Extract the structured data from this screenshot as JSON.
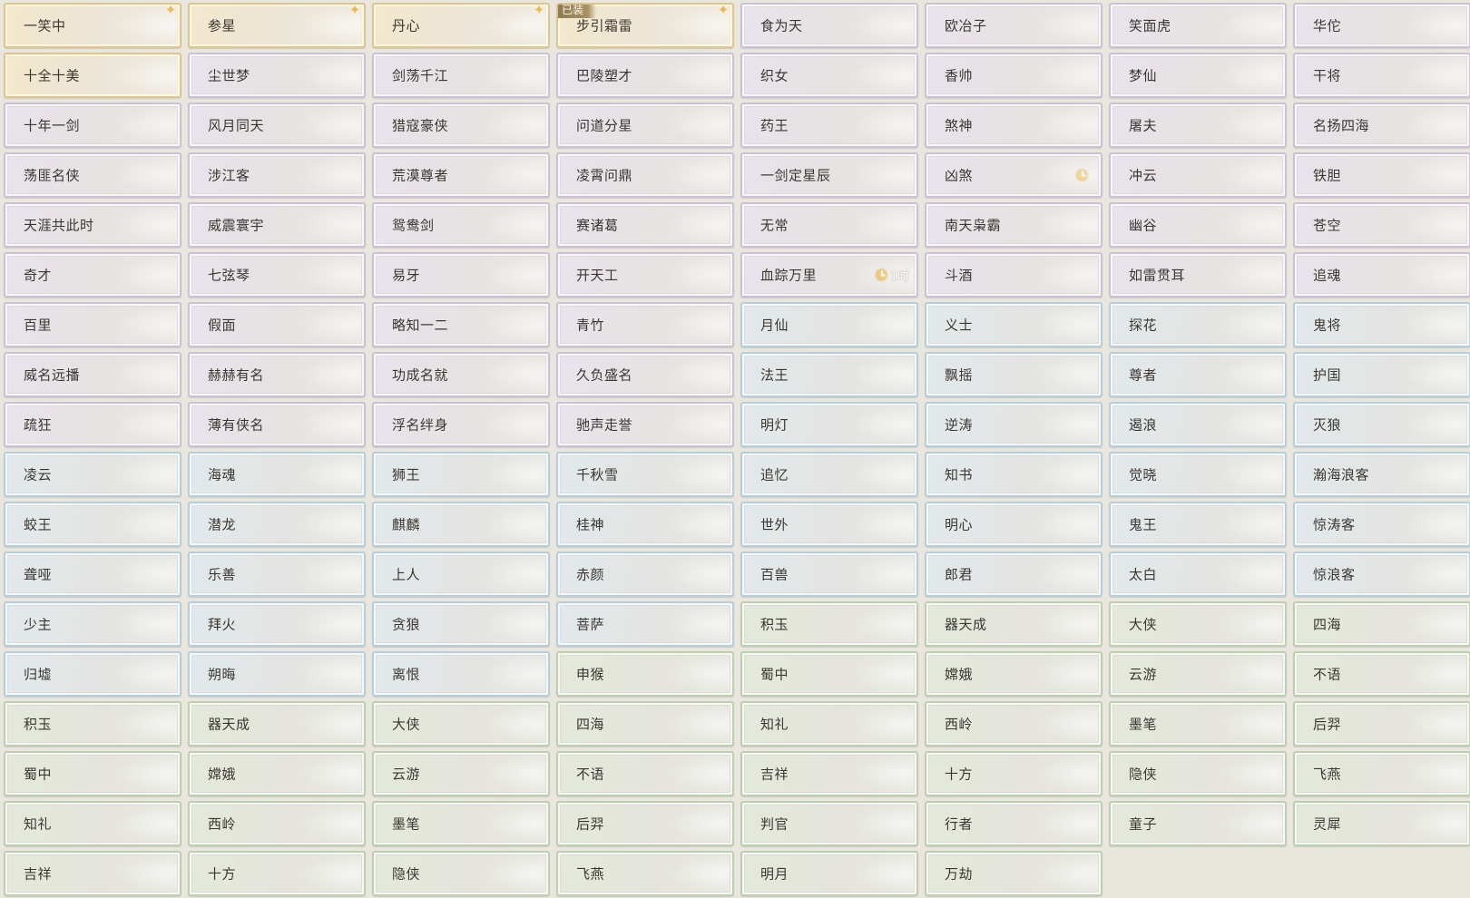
{
  "titles": [
    {
      "label": "一笑中",
      "tier": "gold",
      "sparkle": true
    },
    {
      "label": "参星",
      "tier": "gold",
      "sparkle": true
    },
    {
      "label": "丹心",
      "tier": "gold",
      "sparkle": true
    },
    {
      "label": "步引霜雷",
      "tier": "gold",
      "sparkle": true,
      "equipped": "已装"
    },
    {
      "label": "食为天",
      "tier": "purple"
    },
    {
      "label": "欧冶子",
      "tier": "purple"
    },
    {
      "label": "笑面虎",
      "tier": "purple"
    },
    {
      "label": "华佗",
      "tier": "purple"
    },
    {
      "label": "十全十美",
      "tier": "gold"
    },
    {
      "label": "尘世梦",
      "tier": "purple"
    },
    {
      "label": "剑荡千江",
      "tier": "purple"
    },
    {
      "label": "巴陵塑才",
      "tier": "purple"
    },
    {
      "label": "织女",
      "tier": "purple"
    },
    {
      "label": "香帅",
      "tier": "purple"
    },
    {
      "label": "梦仙",
      "tier": "purple"
    },
    {
      "label": "干将",
      "tier": "purple"
    },
    {
      "label": "十年一剑",
      "tier": "purple"
    },
    {
      "label": "风月同天",
      "tier": "purple"
    },
    {
      "label": "猎寇豪侠",
      "tier": "purple"
    },
    {
      "label": "问道分星",
      "tier": "purple"
    },
    {
      "label": "药王",
      "tier": "purple"
    },
    {
      "label": "煞神",
      "tier": "purple"
    },
    {
      "label": "屠夫",
      "tier": "purple"
    },
    {
      "label": "名扬四海",
      "tier": "purple"
    },
    {
      "label": "荡匪名侠",
      "tier": "purple"
    },
    {
      "label": "涉江客",
      "tier": "purple"
    },
    {
      "label": "荒漠尊者",
      "tier": "purple"
    },
    {
      "label": "凌霄问鼎",
      "tier": "purple"
    },
    {
      "label": "一剑定星辰",
      "tier": "purple"
    },
    {
      "label": "凶煞",
      "tier": "purple",
      "timer": true
    },
    {
      "label": "冲云",
      "tier": "purple"
    },
    {
      "label": "铁胆",
      "tier": "purple"
    },
    {
      "label": "天涯共此时",
      "tier": "purple"
    },
    {
      "label": "威震寰宇",
      "tier": "purple"
    },
    {
      "label": "鸳鸯剑",
      "tier": "purple"
    },
    {
      "label": "赛诸葛",
      "tier": "purple"
    },
    {
      "label": "无常",
      "tier": "purple"
    },
    {
      "label": "南天枭霸",
      "tier": "purple"
    },
    {
      "label": "幽谷",
      "tier": "purple"
    },
    {
      "label": "苍空",
      "tier": "purple"
    },
    {
      "label": "奇才",
      "tier": "purple"
    },
    {
      "label": "七弦琴",
      "tier": "purple"
    },
    {
      "label": "易牙",
      "tier": "purple"
    },
    {
      "label": "开天工",
      "tier": "purple"
    },
    {
      "label": "血踪万里",
      "tier": "purple",
      "timer": true,
      "timer_text": "1时"
    },
    {
      "label": "斗酒",
      "tier": "purple"
    },
    {
      "label": "如雷贯耳",
      "tier": "purple"
    },
    {
      "label": "追魂",
      "tier": "purple"
    },
    {
      "label": "百里",
      "tier": "purple"
    },
    {
      "label": "假面",
      "tier": "purple"
    },
    {
      "label": "略知一二",
      "tier": "purple"
    },
    {
      "label": "青竹",
      "tier": "purple"
    },
    {
      "label": "月仙",
      "tier": "blue"
    },
    {
      "label": "义士",
      "tier": "blue"
    },
    {
      "label": "探花",
      "tier": "blue"
    },
    {
      "label": "鬼将",
      "tier": "blue"
    },
    {
      "label": "威名远播",
      "tier": "purple"
    },
    {
      "label": "赫赫有名",
      "tier": "purple"
    },
    {
      "label": "功成名就",
      "tier": "purple"
    },
    {
      "label": "久负盛名",
      "tier": "purple"
    },
    {
      "label": "法王",
      "tier": "blue"
    },
    {
      "label": "飘摇",
      "tier": "blue"
    },
    {
      "label": "尊者",
      "tier": "blue"
    },
    {
      "label": "护国",
      "tier": "blue"
    },
    {
      "label": "疏狂",
      "tier": "purple"
    },
    {
      "label": "薄有侠名",
      "tier": "purple"
    },
    {
      "label": "浮名绊身",
      "tier": "purple"
    },
    {
      "label": "驰声走誉",
      "tier": "purple"
    },
    {
      "label": "明灯",
      "tier": "blue"
    },
    {
      "label": "逆涛",
      "tier": "blue"
    },
    {
      "label": "遏浪",
      "tier": "blue"
    },
    {
      "label": "灭狼",
      "tier": "blue"
    },
    {
      "label": "凌云",
      "tier": "blue"
    },
    {
      "label": "海魂",
      "tier": "blue"
    },
    {
      "label": "狮王",
      "tier": "blue"
    },
    {
      "label": "千秋雪",
      "tier": "blue"
    },
    {
      "label": "追忆",
      "tier": "blue"
    },
    {
      "label": "知书",
      "tier": "blue"
    },
    {
      "label": "觉晓",
      "tier": "blue"
    },
    {
      "label": "瀚海浪客",
      "tier": "blue"
    },
    {
      "label": "蛟王",
      "tier": "blue"
    },
    {
      "label": "潜龙",
      "tier": "blue"
    },
    {
      "label": "麒麟",
      "tier": "blue"
    },
    {
      "label": "桂神",
      "tier": "blue"
    },
    {
      "label": "世外",
      "tier": "blue"
    },
    {
      "label": "明心",
      "tier": "blue"
    },
    {
      "label": "鬼王",
      "tier": "blue"
    },
    {
      "label": "惊涛客",
      "tier": "blue"
    },
    {
      "label": "聋哑",
      "tier": "blue"
    },
    {
      "label": "乐善",
      "tier": "blue"
    },
    {
      "label": "上人",
      "tier": "blue"
    },
    {
      "label": "赤颜",
      "tier": "blue"
    },
    {
      "label": "百兽",
      "tier": "blue"
    },
    {
      "label": "郎君",
      "tier": "blue"
    },
    {
      "label": "太白",
      "tier": "blue"
    },
    {
      "label": "惊浪客",
      "tier": "blue"
    },
    {
      "label": "少主",
      "tier": "blue"
    },
    {
      "label": "拜火",
      "tier": "blue"
    },
    {
      "label": "贪狼",
      "tier": "blue"
    },
    {
      "label": "菩萨",
      "tier": "blue"
    },
    {
      "label": "积玉",
      "tier": "green"
    },
    {
      "label": "器天成",
      "tier": "green"
    },
    {
      "label": "大侠",
      "tier": "green"
    },
    {
      "label": "四海",
      "tier": "green"
    },
    {
      "label": "归墟",
      "tier": "blue"
    },
    {
      "label": "朔晦",
      "tier": "blue"
    },
    {
      "label": "离恨",
      "tier": "blue"
    },
    {
      "label": "申猴",
      "tier": "green"
    },
    {
      "label": "蜀中",
      "tier": "green"
    },
    {
      "label": "嫦娥",
      "tier": "green"
    },
    {
      "label": "云游",
      "tier": "green"
    },
    {
      "label": "不语",
      "tier": "green"
    },
    {
      "label": "积玉",
      "tier": "green"
    },
    {
      "label": "器天成",
      "tier": "green"
    },
    {
      "label": "大侠",
      "tier": "green"
    },
    {
      "label": "四海",
      "tier": "green"
    },
    {
      "label": "知礼",
      "tier": "green"
    },
    {
      "label": "西岭",
      "tier": "green"
    },
    {
      "label": "墨笔",
      "tier": "green"
    },
    {
      "label": "后羿",
      "tier": "green"
    },
    {
      "label": "蜀中",
      "tier": "green"
    },
    {
      "label": "嫦娥",
      "tier": "green"
    },
    {
      "label": "云游",
      "tier": "green"
    },
    {
      "label": "不语",
      "tier": "green"
    },
    {
      "label": "吉祥",
      "tier": "green"
    },
    {
      "label": "十方",
      "tier": "green"
    },
    {
      "label": "隐侠",
      "tier": "green"
    },
    {
      "label": "飞燕",
      "tier": "green"
    },
    {
      "label": "知礼",
      "tier": "green"
    },
    {
      "label": "西岭",
      "tier": "green"
    },
    {
      "label": "墨笔",
      "tier": "green"
    },
    {
      "label": "后羿",
      "tier": "green"
    },
    {
      "label": "判官",
      "tier": "green"
    },
    {
      "label": "行者",
      "tier": "green"
    },
    {
      "label": "童子",
      "tier": "green"
    },
    {
      "label": "灵犀",
      "tier": "green"
    },
    {
      "label": "吉祥",
      "tier": "green"
    },
    {
      "label": "十方",
      "tier": "green"
    },
    {
      "label": "隐侠",
      "tier": "green"
    },
    {
      "label": "飞燕",
      "tier": "green"
    },
    {
      "label": "明月",
      "tier": "green"
    },
    {
      "label": "万劫",
      "tier": "green"
    }
  ]
}
